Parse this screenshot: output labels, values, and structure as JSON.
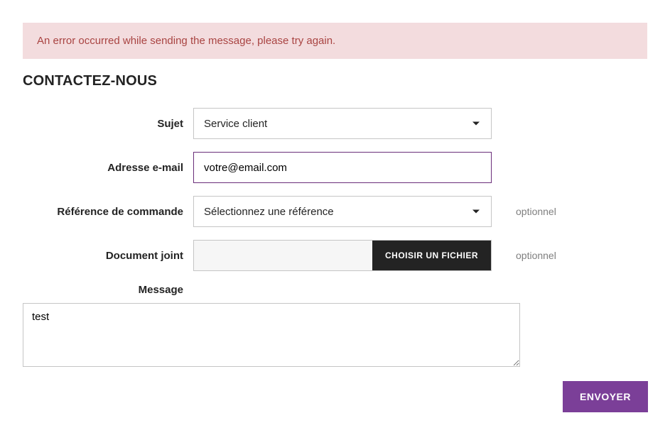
{
  "error": {
    "message": "An error occurred while sending the message, please try again."
  },
  "page": {
    "title": "Contactez-nous"
  },
  "form": {
    "subject": {
      "label": "Sujet",
      "selected": "Service client"
    },
    "email": {
      "label": "Adresse e-mail",
      "value": "votre@email.com"
    },
    "order_ref": {
      "label": "Référence de commande",
      "placeholder": "Sélectionnez une référence",
      "optional": "optionnel"
    },
    "attachment": {
      "label": "Document joint",
      "button": "Choisir un fichier",
      "optional": "optionnel"
    },
    "message": {
      "label": "Message",
      "value": "test"
    },
    "submit": {
      "label": "Envoyer"
    }
  }
}
